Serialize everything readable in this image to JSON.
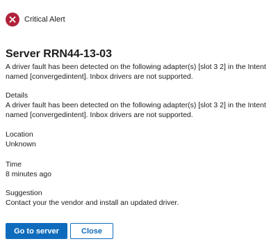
{
  "alert": {
    "severity_label": "Critical Alert",
    "icon": "error-circle-icon",
    "icon_color": "#b0223a"
  },
  "title": "Server RRN44-13-03",
  "description": "A driver fault has been detected on the following adapter(s) [slot 3 2] in the Intent named [convergedintent]. Inbox drivers are not supported.",
  "details": {
    "heading": "Details",
    "text": "A driver fault has been detected on the following adapter(s) [slot 3 2] in the Intent named [convergedintent]. Inbox drivers are not supported."
  },
  "location": {
    "heading": "Location",
    "value": "Unknown"
  },
  "time": {
    "heading": "Time",
    "value": "8 minutes ago"
  },
  "suggestion": {
    "heading": "Suggestion",
    "text": "Contact your the vendor and install an updated driver."
  },
  "actions": {
    "primary_label": "Go to server",
    "secondary_label": "Close",
    "accent_color": "#0f6cbd"
  }
}
